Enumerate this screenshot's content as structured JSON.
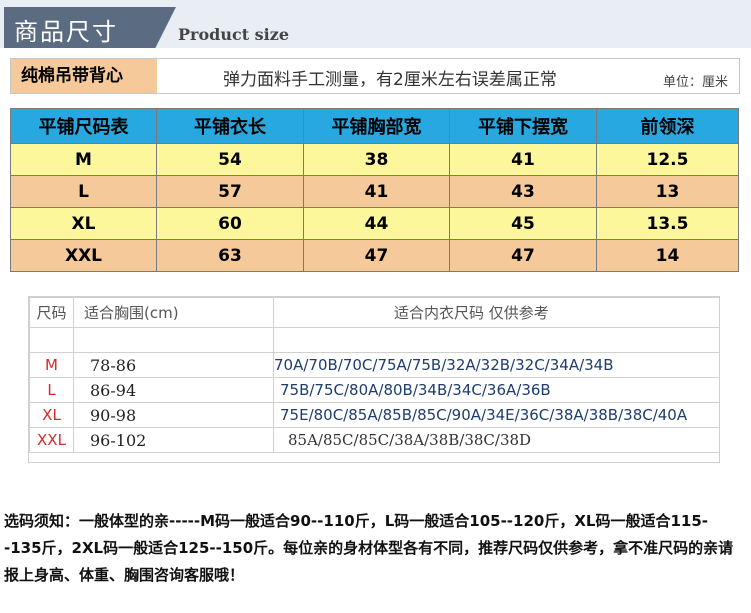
{
  "header": {
    "title": "商品尺寸",
    "subtitle": "Product size"
  },
  "info": {
    "product": "纯棉吊带背心",
    "note": "弹力面料手工测量，有2厘米左右误差属正常",
    "unit": "单位：厘米"
  },
  "size_table": {
    "headers": [
      "平铺尺码表",
      "平铺衣长",
      "平铺胸部宽",
      "平铺下摆宽",
      "前领深"
    ],
    "rows": [
      [
        "M",
        "54",
        "38",
        "41",
        "12.5"
      ],
      [
        "L",
        "57",
        "41",
        "43",
        "13"
      ],
      [
        "XL",
        "60",
        "44",
        "45",
        "13.5"
      ],
      [
        "XXL",
        "63",
        "47",
        "47",
        "14"
      ]
    ]
  },
  "fit_table": {
    "headers": [
      "尺码",
      "适合胸围(cm)",
      "适合内衣尺码    仅供参考"
    ],
    "rows": [
      [
        "M",
        "78-86",
        "70A/70B/70C/75A/75B/32A/32B/32C/34A/34B"
      ],
      [
        "L",
        "86-94",
        "75B/75C/80A/80B/34B/34C/36A/36B"
      ],
      [
        "XL",
        "90-98",
        "75E/80C/85A/85B/85C/90A/34E/36C/38A/38B/38C/40A"
      ],
      [
        "XXL",
        "96-102",
        "85A/85C/85C/38A/38B/38C/38D"
      ]
    ]
  },
  "notice": "选码须知：一般体型的亲-----M码一般适合90--110斤，L码一般适合105--120斤，XL码一般适合115--135斤，2XL码一般适合125--150斤。每位亲的身材体型各有不同，推荐尺码仅供参考，拿不准尺码的亲请报上身高、体重、胸围咨询客服哦！",
  "colors": {
    "header_band": "#5a6b82",
    "table_header": "#27a8e0",
    "row_yellow": "#fcf79a",
    "row_orange": "#f5c99a",
    "size_red": "#d42a2a"
  }
}
